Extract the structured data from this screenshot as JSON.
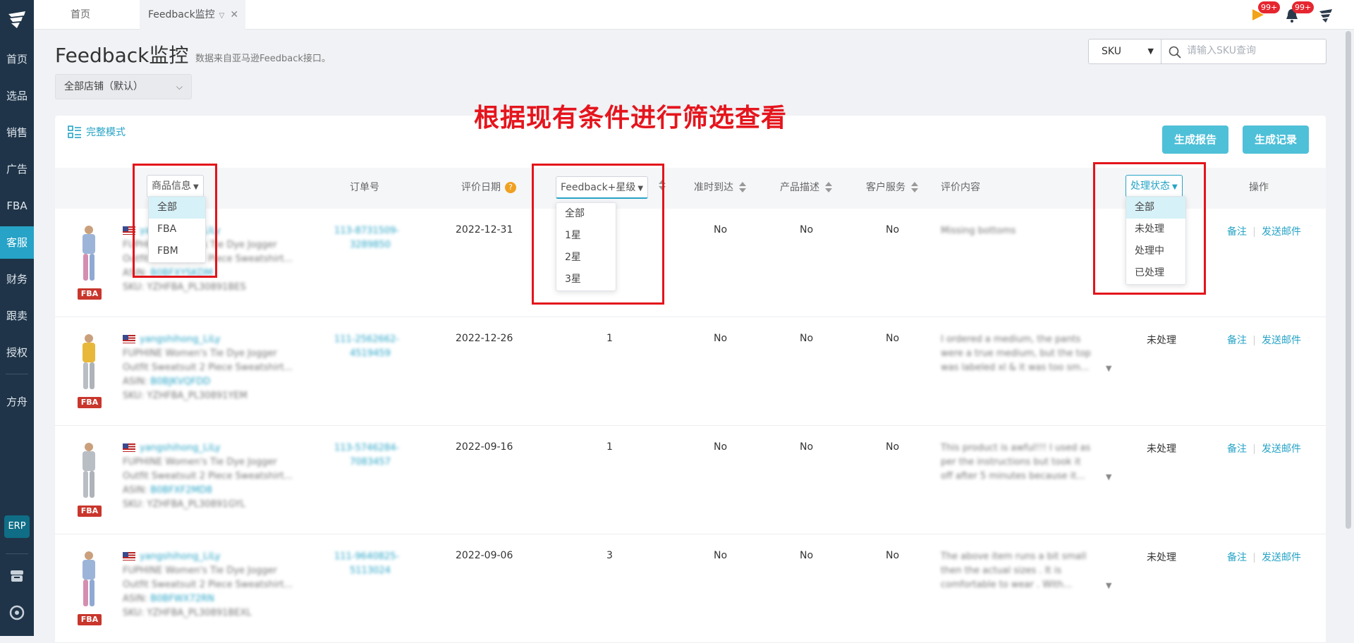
{
  "sidebar": {
    "items": [
      {
        "label": "首页",
        "active": false
      },
      {
        "label": "选品",
        "active": false
      },
      {
        "label": "销售",
        "active": false
      },
      {
        "label": "广告",
        "active": false
      },
      {
        "label": "FBA",
        "active": false
      },
      {
        "label": "客服",
        "active": true
      },
      {
        "label": "财务",
        "active": false
      },
      {
        "label": "跟卖",
        "active": false
      },
      {
        "label": "授权",
        "active": false
      },
      {
        "label": "方舟",
        "active": false
      }
    ],
    "erp_label": "ERP",
    "bottom_icons": [
      "store-icon",
      "support-icon"
    ]
  },
  "tabs": {
    "home": "首页",
    "current": "Feedback监控"
  },
  "topbar": {
    "flag_badge": "99+",
    "bell_badge": "99+"
  },
  "page": {
    "title": "Feedback监控",
    "subtitle": "数据来自亚马逊Feedback接口。",
    "store_select": "全部店铺（默认）",
    "search_type": "SKU",
    "search_placeholder": "请输入SKU查询"
  },
  "annotation": "根据现有条件进行筛选查看",
  "toolbar": {
    "mode_label": "完整模式",
    "report_button": "生成报告",
    "records_button": "生成记录"
  },
  "columns": {
    "product_info": "商品信息",
    "order_no": "订单号",
    "review_date": "评价日期",
    "help": "?",
    "rating": "Feedback+星级",
    "on_time": "准时到达",
    "description": "产品描述",
    "service": "客户服务",
    "content": "评价内容",
    "status": "处理状态",
    "actions": "操作"
  },
  "filters": {
    "product_options": [
      "全部",
      "FBA",
      "FBM"
    ],
    "rating_options": [
      "全部",
      "1星",
      "2星",
      "3星"
    ],
    "status_options": [
      "全部",
      "未处理",
      "处理中",
      "已处理"
    ]
  },
  "rows": [
    {
      "seller": "yangshihong_LiLy",
      "title1": "FUPHINE Women's Tie Dye Jogger",
      "title2": "Outfit Sweatsuit 2 Piece Sweatshirt...",
      "asin": "B0BFXYSKDM",
      "sku": "YZHFBA_PL30891BES",
      "order1": "113-8731509-",
      "order2": "3289850",
      "date": "2022-12-31",
      "rating": "",
      "on_time": "No",
      "desc": "No",
      "service": "No",
      "content1": "Missing bottoms",
      "content2": "",
      "content3": "",
      "status": "",
      "note": "备注",
      "email": "发送邮件",
      "badge": "FBA"
    },
    {
      "seller": "yangshihong_LiLy",
      "title1": "FUPHINE Women's Tie Dye Jogger",
      "title2": "Outfit Sweatsuit 2 Piece Sweatshirt...",
      "asin": "B0BJKVQFDD",
      "sku": "YZHFBA_PL30891YEM",
      "order1": "111-2562662-",
      "order2": "4519459",
      "date": "2022-12-26",
      "rating": "1",
      "on_time": "No",
      "desc": "No",
      "service": "No",
      "content1": "I ordered a medium, the pants",
      "content2": "were a true medium, but the top",
      "content3": "was labeled xl & it was too sm...",
      "status": "未处理",
      "note": "备注",
      "email": "发送邮件",
      "badge": "FBA"
    },
    {
      "seller": "yangshihong_LiLy",
      "title1": "FUPHINE Women's Tie Dye Jogger",
      "title2": "Outfit Sweatsuit 2 Piece Sweatshirt...",
      "asin": "B0BFXF2MD8",
      "sku": "YZHFBA_PL30891GYL",
      "order1": "113-5746284-",
      "order2": "7083457",
      "date": "2022-09-16",
      "rating": "1",
      "on_time": "No",
      "desc": "No",
      "service": "No",
      "content1": "This product is awful!!! I used as",
      "content2": "per the instructions but took it",
      "content3": "off after 5 minutes because it...",
      "status": "未处理",
      "note": "备注",
      "email": "发送邮件",
      "badge": "FBA"
    },
    {
      "seller": "yangshihong_LiLy",
      "title1": "FUPHINE Women's Tie Dye Jogger",
      "title2": "Outfit Sweatsuit 2 Piece Sweatshirt...",
      "asin": "B0BFWX72RN",
      "sku": "YZHFBA_PL30891BEXL",
      "order1": "111-9640825-",
      "order2": "5113024",
      "date": "2022-09-06",
      "rating": "3",
      "on_time": "No",
      "desc": "No",
      "service": "No",
      "content1": "The above item runs a bit small",
      "content2": "then the actual sizes . It is",
      "content3": "comfortable to wear . With...",
      "status": "未处理",
      "note": "备注",
      "email": "发送邮件",
      "badge": "FBA"
    }
  ],
  "colors": {
    "accent": "#26a3c6",
    "sidebar": "#1f3448",
    "highlight": "#e3141b",
    "button": "#4ec0d8"
  }
}
